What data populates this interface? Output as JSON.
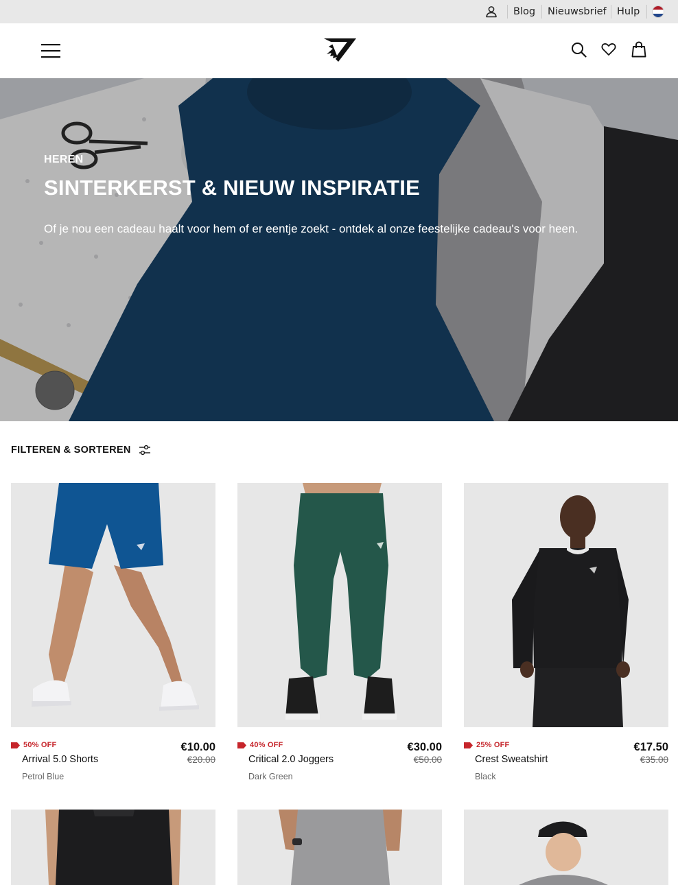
{
  "utility_bar": {
    "links": [
      "Blog",
      "Nieuwsbrief",
      "Hulp"
    ]
  },
  "hero": {
    "eyebrow": "HEREN",
    "headline": "SINTERKERST & NIEUW INSPIRATIE",
    "subline": "Of je nou een cadeau haalt voor hem of er eentje zoekt - ontdek al onze feestelijke cadeau's voor heen."
  },
  "filter": {
    "label": "FILTEREN & SORTEREN"
  },
  "products": [
    {
      "discount": "50% OFF",
      "name": "Arrival 5.0 Shorts",
      "color": "Petrol Blue",
      "price": "€10.00",
      "old_price": "€20.00",
      "swatch": "#0d4f8f"
    },
    {
      "discount": "40% OFF",
      "name": "Critical 2.0 Joggers",
      "color": "Dark Green",
      "price": "€30.00",
      "old_price": "€50.00",
      "swatch": "#234f44"
    },
    {
      "discount": "25% OFF",
      "name": "Crest Sweatshirt",
      "color": "Black",
      "price": "€17.50",
      "old_price": "€35.00",
      "swatch": "#1c1c1e"
    }
  ],
  "colors": {
    "discount_red": "#c6252b",
    "utility_bg": "#e8e8e8",
    "image_bg": "#e6e6e6"
  }
}
